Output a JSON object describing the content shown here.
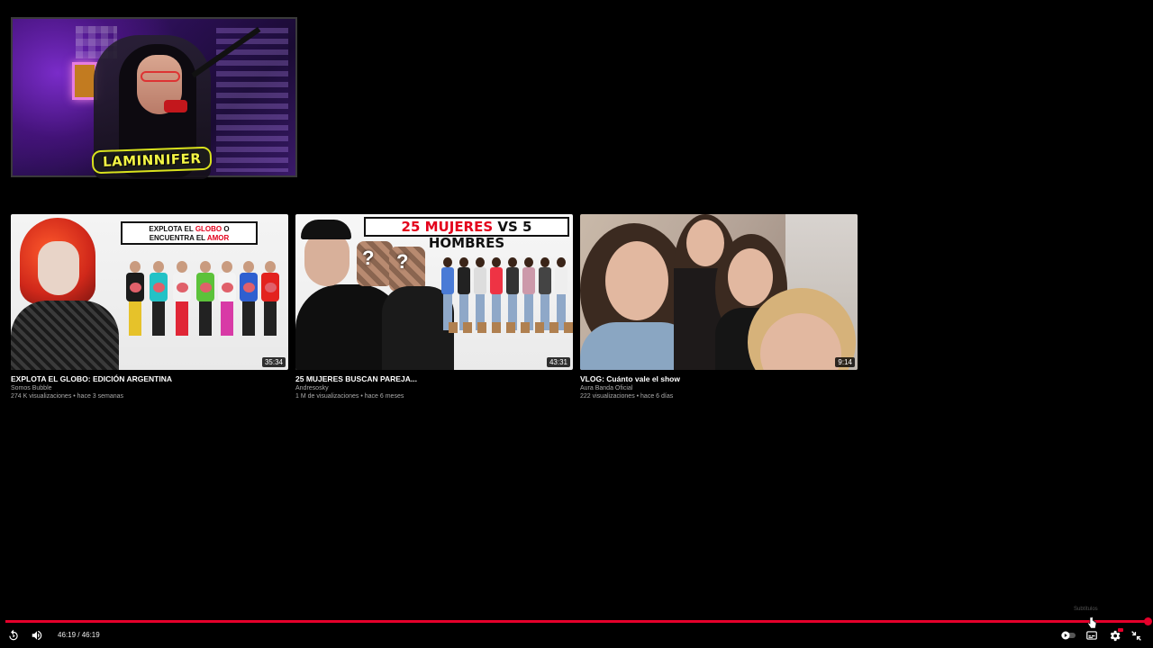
{
  "streamer": {
    "tag": "LAMINNIFER"
  },
  "endscreen": {
    "videos": [
      {
        "title": "EXPLOTA EL GLOBO: EDICIÓN ARGENTINA",
        "channel": "Somos Bubble",
        "meta": "274 K visualizaciones • hace 3 semanas",
        "duration": "35:34",
        "thumb_text_1": "EXPLOTA EL ",
        "thumb_text_red_1": "GLOBO",
        "thumb_text_2": " O",
        "thumb_text_3": "ENCUENTRA EL ",
        "thumb_text_red_2": "AMOR"
      },
      {
        "title": "25 MUJERES BUSCAN PAREJA...",
        "channel": "Andresosky",
        "meta": "1 M de visualizaciones • hace 6 meses",
        "duration": "43:31",
        "thumb_text_red": "25 MUJERES",
        "thumb_text_black": " VS 5 HOMBRES"
      },
      {
        "title": "VLOG: Cuánto vale el show",
        "channel": "Aura Banda Oficial",
        "meta": "222 visualizaciones • hace 6 días",
        "duration": "9:14"
      }
    ]
  },
  "player": {
    "subtitle_hint": "Subtítulos",
    "time_display": "46:19 / 46:19",
    "progress_fraction": 1.0,
    "accent_color": "#e5002b",
    "icons": {
      "replay": "replay-icon",
      "volume": "volume-icon",
      "autoplay": "autoplay-toggle-icon",
      "subtitles": "subtitles-icon",
      "settings": "settings-gear-icon",
      "exit_fullscreen": "exit-fullscreen-icon"
    }
  }
}
